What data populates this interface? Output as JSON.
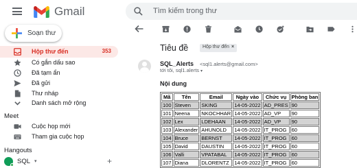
{
  "header": {
    "app_name": "Gmail",
    "search_placeholder": "Tìm kiếm trong thư",
    "brand_colors": {
      "red": "#ea4335",
      "blue": "#4285f4",
      "green": "#34a853",
      "yellow": "#fbbc04"
    }
  },
  "sidebar": {
    "compose_label": "Soạn thư",
    "items": [
      {
        "label": "Hộp thư đến",
        "count": "353",
        "icon": "inbox-icon",
        "active": true
      },
      {
        "label": "Có gắn dấu sao",
        "icon": "star-icon"
      },
      {
        "label": "Đã tạm ẩn",
        "icon": "clock-icon"
      },
      {
        "label": "Đã gửi",
        "icon": "send-icon"
      },
      {
        "label": "Thư nháp",
        "icon": "draft-icon"
      },
      {
        "label": "Danh sách mở rộng",
        "icon": "chevron-down-icon"
      }
    ],
    "meet": {
      "title": "Meet",
      "items": [
        {
          "label": "Cuộc họp mới",
          "icon": "video-icon"
        },
        {
          "label": "Tham gia cuộc họp",
          "icon": "keyboard-icon"
        }
      ]
    },
    "hangouts": {
      "title": "Hangouts",
      "user": "SQL",
      "caret": "▾",
      "add": "+"
    },
    "active_color": "#d93025",
    "active_bg": "#fce8e6"
  },
  "toolbar": {
    "icons": [
      "back-arrow-icon",
      "archive-icon",
      "report-spam-icon",
      "delete-icon",
      "mark-unread-icon",
      "snooze-icon",
      "add-task-icon",
      "move-to-icon",
      "label-icon"
    ]
  },
  "message": {
    "subject": "Tiêu đề",
    "label_chip": "Hộp thư đến",
    "label_chip_close": "×",
    "sender_name": "SQL_Alerts",
    "sender_email": "<sql1.alerts@gmail.com>",
    "recipients": "tới tôi, sql1.alerts",
    "recipients_caret": "▾",
    "content_title": "Nội dung"
  },
  "table": {
    "headers": [
      "Mã",
      "Tên",
      "Email",
      "Ngày vào",
      "Chức vụ",
      "Phòng ban"
    ],
    "rows": [
      [
        "100",
        "Steven",
        "SKING",
        "14-05-2022",
        "AD_PRES",
        "90"
      ],
      [
        "101",
        "Neena",
        "NKOCHHAR",
        "14-05-2022",
        "AD_VP",
        "90"
      ],
      [
        "102",
        "Lex",
        "LDEHAAN",
        "14-05-2022",
        "AD_VP",
        "90"
      ],
      [
        "103",
        "Alexander",
        "AHUNOLD",
        "14-05-2022",
        "IT_PROG",
        "60"
      ],
      [
        "104",
        "Bruce",
        "BERNST",
        "14-05-2022",
        "IT_PROG",
        "60"
      ],
      [
        "105",
        "David",
        "DAUSTIN",
        "14-05-2022",
        "IT_PROG",
        "60"
      ],
      [
        "106",
        "Valli",
        "VPATABAL",
        "14-05-2022",
        "IT_PROG",
        "60"
      ],
      [
        "107",
        "Diana",
        "DLORENTZ",
        "14-05-2022",
        "IT_PROG",
        "60"
      ]
    ],
    "shade_color": "#d3d3d3"
  }
}
